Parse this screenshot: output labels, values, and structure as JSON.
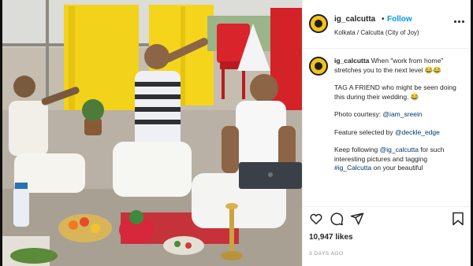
{
  "post": {
    "username": "ig_calcutta",
    "separator": "•",
    "follow_label": "Follow",
    "location": "Kolkata / Calcutta (City of Joy)",
    "more_icon": "more-options-icon",
    "caption": {
      "username": "ig_calcutta",
      "line1": "When \"work from home\" stretches you to the next level 😂😂",
      "line2": "TAG A FRIEND who might be seen doing this during their wedding. 😂",
      "line3_prefix": "Photo courtesy: ",
      "line3_mention": "@iam_sreein",
      "line4_prefix": "Feature selected by ",
      "line4_mention": "@deckle_edge",
      "line5_prefix": "Keep following ",
      "line5_mention": "@ig_calcutta",
      "line5_mid": " for such interesting pictures and tagging ",
      "line5_tag": "#ig_Calcutta",
      "line5_suffix": " on your beautiful"
    },
    "actions": [
      "heart-icon",
      "comment-icon",
      "share-icon",
      "bookmark-icon"
    ],
    "likes": "10,947 likes",
    "date": "3 DAYS AGO"
  },
  "colors": {
    "accent": "#0095f6",
    "mention": "#00376b",
    "avatar": "#f3c21b"
  }
}
